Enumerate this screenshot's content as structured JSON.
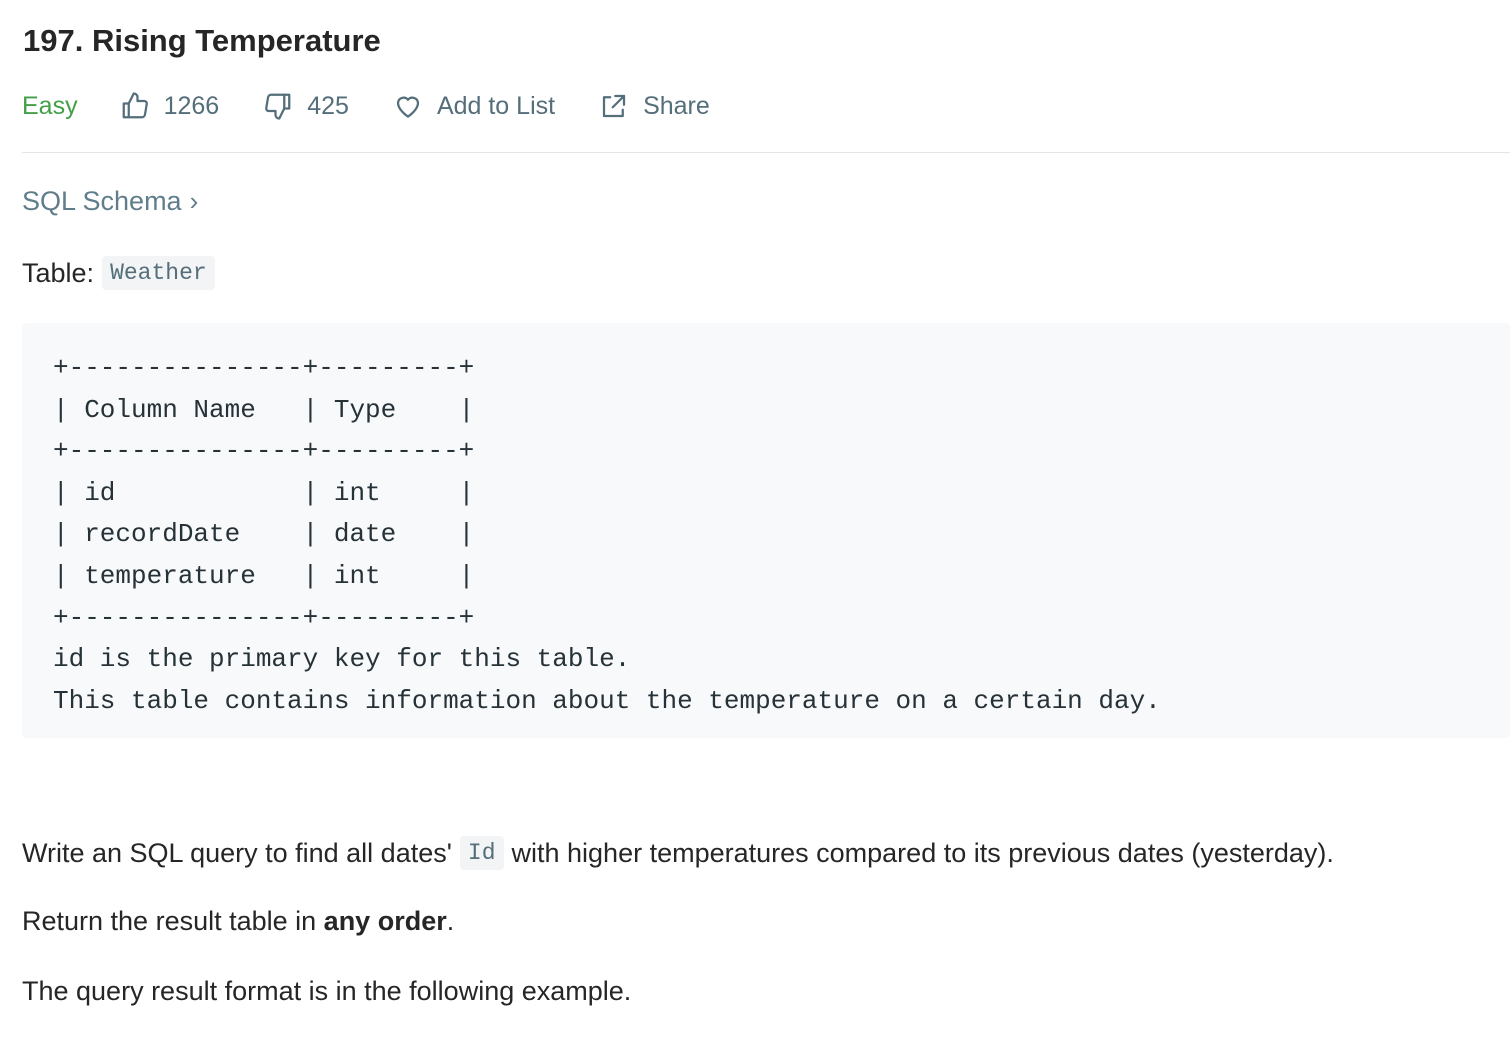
{
  "problem": {
    "title": "197. Rising Temperature",
    "difficulty": "Easy",
    "likes": "1266",
    "dislikes": "425",
    "add_to_list_label": "Add to List",
    "share_label": "Share"
  },
  "colors": {
    "difficulty_easy": "#43a047",
    "meta_text": "#546e7a",
    "code_bg": "#f7f9fa"
  },
  "icons": {
    "like": "thumbs-up-icon",
    "dislike": "thumbs-down-icon",
    "add_to_list": "heart-icon",
    "share": "share-icon",
    "schema_chevron": "chevron-right-icon"
  },
  "schema": {
    "link_label": "SQL Schema",
    "chevron": "›"
  },
  "table_intro": {
    "label": "Table:",
    "table_name": "Weather"
  },
  "schema_block": {
    "lines": [
      "+---------------+---------+",
      "| Column Name   | Type    |",
      "+---------------+---------+",
      "| id            | int     |",
      "| recordDate    | date    |",
      "| temperature   | int     |",
      "+---------------+---------+",
      "id is the primary key for this table.",
      "This table contains information about the temperature on a certain day."
    ]
  },
  "description": {
    "p1_before": "Write an SQL query to find all dates'",
    "p1_code": "Id",
    "p1_after": "with higher temperatures compared to its previous dates (yesterday).",
    "p2_before": "Return the result table in ",
    "p2_bold": "any order",
    "p2_after": ".",
    "p3": "The query result format is in the following example."
  }
}
